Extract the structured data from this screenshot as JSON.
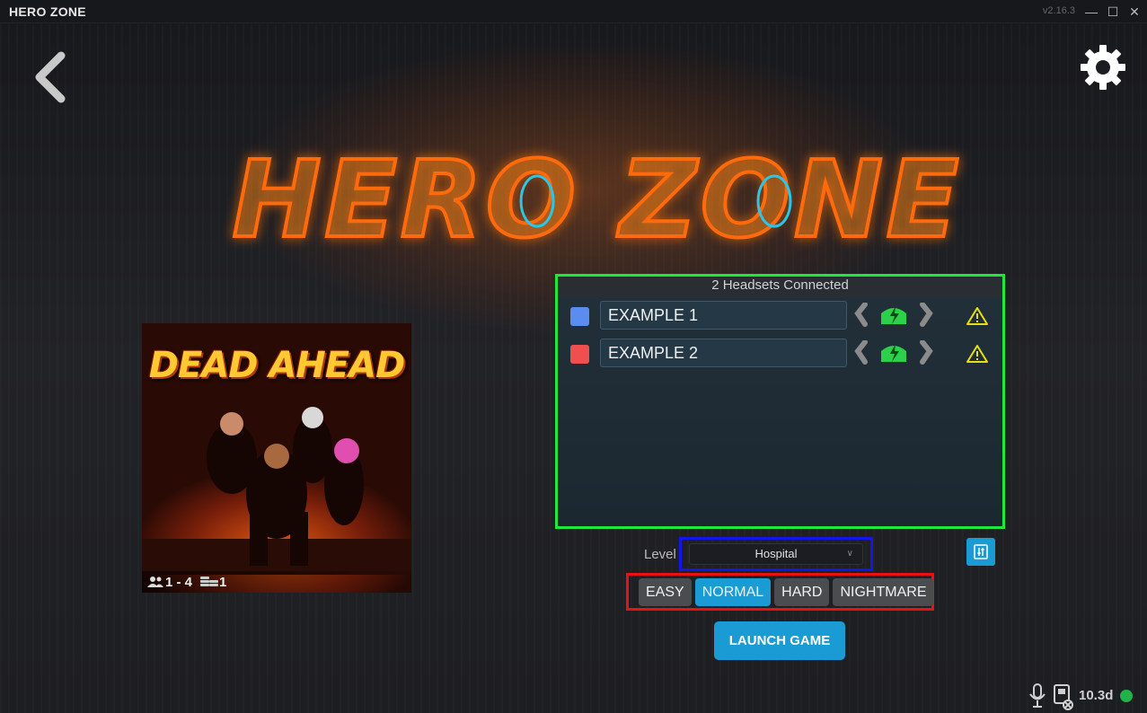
{
  "app": {
    "title": "HERO ZONE",
    "version": "v2.16.3"
  },
  "window_controls": {
    "minimize": "—",
    "maximize": "☐",
    "close": "✕"
  },
  "logo": {
    "text": "HERO ZONE"
  },
  "game": {
    "title": "DEAD AHEAD",
    "players": "1 - 4",
    "credits": "1"
  },
  "headsets": {
    "header": "2 Headsets Connected",
    "items": [
      {
        "name": "EXAMPLE 1",
        "color": "#5b8cf0"
      },
      {
        "name": "EXAMPLE 2",
        "color": "#ef4f4f"
      }
    ]
  },
  "level": {
    "label": "Level",
    "selected": "Hospital"
  },
  "difficulty": {
    "options": [
      "EASY",
      "NORMAL",
      "HARD",
      "NIGHTMARE"
    ],
    "selected": "NORMAL"
  },
  "launch": {
    "label": "LAUNCH GAME"
  },
  "status": {
    "value": "10.3d",
    "connected_color": "#21b24a"
  },
  "colors": {
    "accent": "#1a9bd4",
    "panel_border": "#1ee83a",
    "level_border": "#1216e8",
    "difficulty_border": "#e81212"
  }
}
